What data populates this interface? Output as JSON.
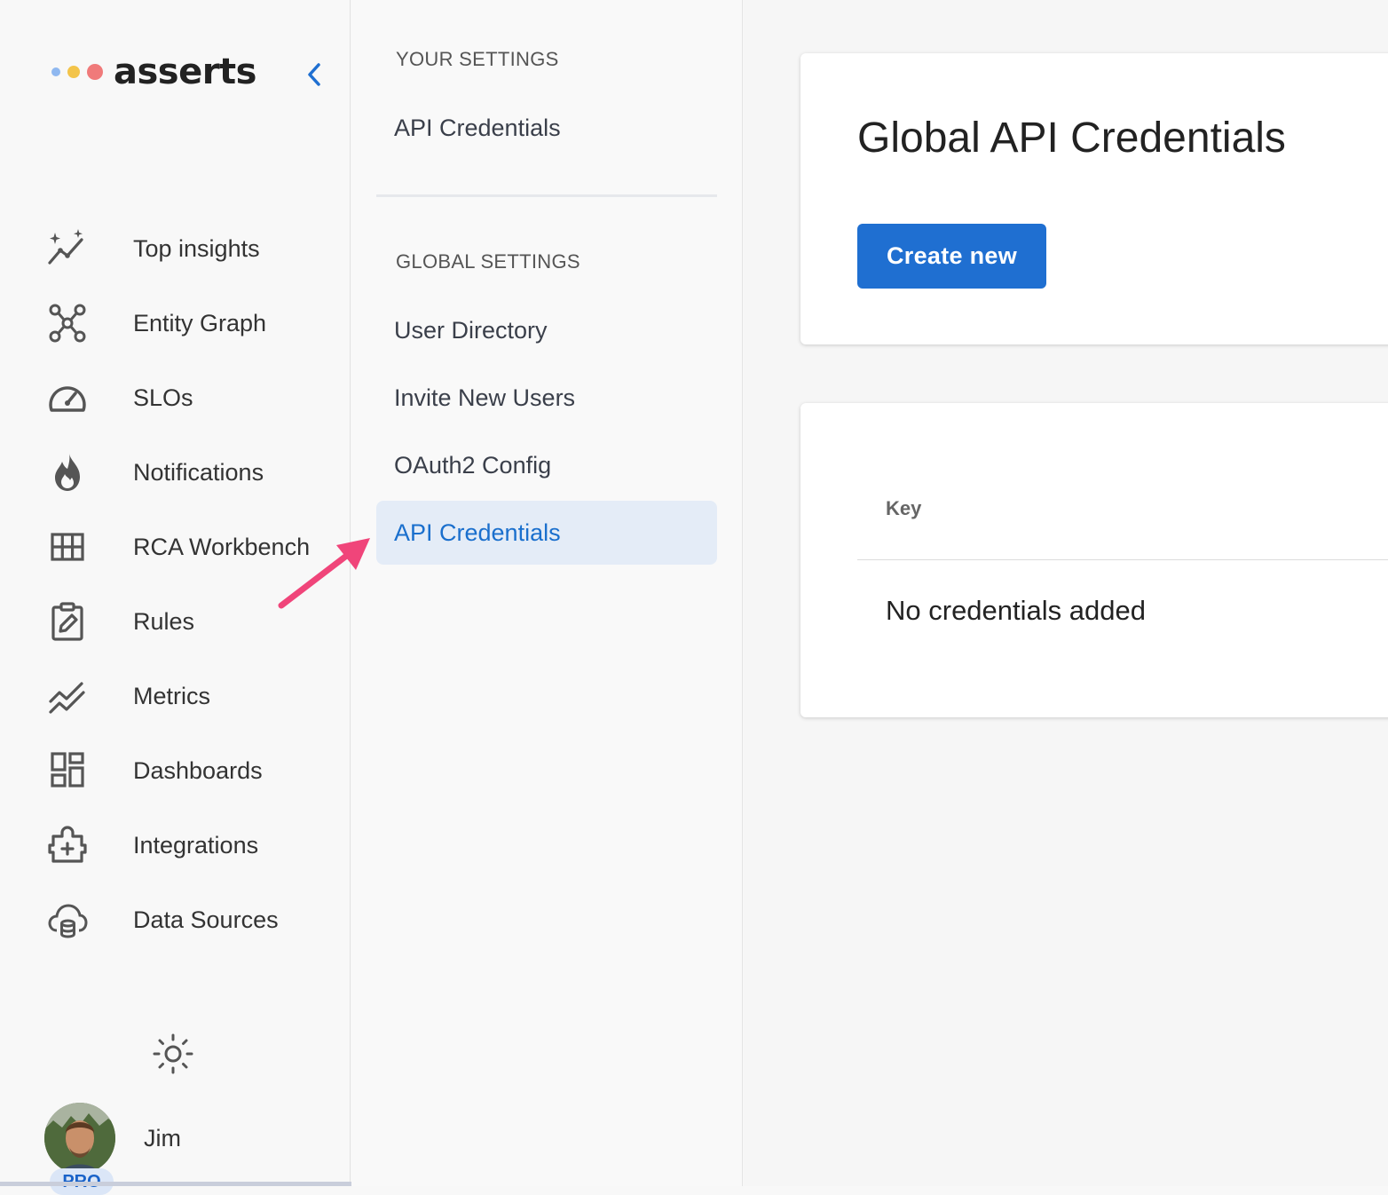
{
  "brand": {
    "name": "asserts",
    "dot_colors": [
      "#8fb8f0",
      "#f3c44a",
      "#f07a7a"
    ]
  },
  "sidebar": {
    "items": [
      {
        "label": "Top insights",
        "icon": "insights-icon"
      },
      {
        "label": "Entity Graph",
        "icon": "graph-icon"
      },
      {
        "label": "SLOs",
        "icon": "gauge-icon"
      },
      {
        "label": "Notifications",
        "icon": "flame-icon"
      },
      {
        "label": "RCA Workbench",
        "icon": "grid-icon"
      },
      {
        "label": "Rules",
        "icon": "clipboard-edit-icon"
      },
      {
        "label": "Metrics",
        "icon": "metrics-icon"
      },
      {
        "label": "Dashboards",
        "icon": "dashboard-icon"
      },
      {
        "label": "Integrations",
        "icon": "integration-icon"
      },
      {
        "label": "Data Sources",
        "icon": "cloud-database-icon"
      }
    ],
    "user": {
      "name": "Jim",
      "badge": "PRO"
    }
  },
  "settings": {
    "your_heading": "YOUR SETTINGS",
    "your_items": [
      "API Credentials"
    ],
    "global_heading": "GLOBAL SETTINGS",
    "global_items": [
      "User Directory",
      "Invite New Users",
      "OAuth2 Config",
      "API Credentials"
    ],
    "active_item": "API Credentials"
  },
  "main": {
    "title": "Global API Credentials",
    "create_button": "Create new",
    "table": {
      "column_key": "Key",
      "empty_message": "No credentials added"
    }
  },
  "colors": {
    "accent": "#1f6fd1",
    "active_bg": "#e4ecf7",
    "annotation_arrow": "#f0457a"
  }
}
